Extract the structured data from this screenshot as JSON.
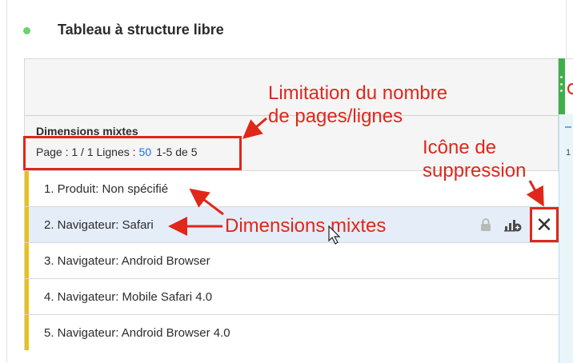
{
  "panel": {
    "title": "Tableau à structure libre",
    "status_color": "#6dd16d"
  },
  "table": {
    "dimension_header": "Dimensions mixtes",
    "pager": {
      "page_text": "Page : 1 / 1 Lignes :",
      "rows_per_page": "50",
      "range_text": "1-5 de 5"
    },
    "right_column_peek": "1",
    "rows": [
      {
        "label": "1. Produit: Non spécifié",
        "selected": false
      },
      {
        "label": "2. Navigateur: Safari",
        "selected": true
      },
      {
        "label": "3. Navigateur: Android Browser",
        "selected": false
      },
      {
        "label": "4. Navigateur: Mobile Safari 4.0",
        "selected": false
      },
      {
        "label": "5. Navigateur: Android Browser 4.0",
        "selected": false
      }
    ],
    "row_actions": {
      "lock_icon": "lock-icon",
      "chart_icon": "add-visualization-icon",
      "close_icon": "close-icon",
      "close_glyph": "✕"
    }
  },
  "annotations": {
    "pager_note_line1": "Limitation du nombre",
    "pager_note_line2": "de pages/lignes",
    "delete_note_line1": "Icône de",
    "delete_note_line2": "suppression",
    "dimensions_note": "Dimensions mixtes",
    "color": "#e0271a"
  },
  "colors": {
    "accent_blue": "#1473e6",
    "row_marker_yellow": "#e6c21a",
    "column_green": "#3fae49",
    "selected_row": "#e5edf8"
  }
}
